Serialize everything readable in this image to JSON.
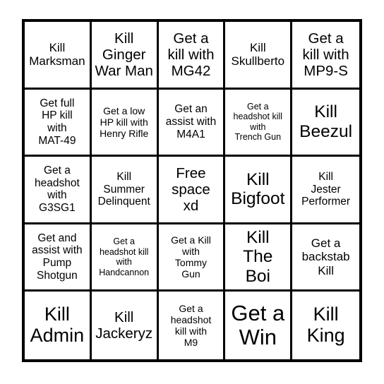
{
  "card": {
    "type": "bingo-card",
    "rows": 5,
    "columns": 5,
    "border_color": "#000000",
    "background_color": "#ffffff",
    "text_color": "#000000",
    "free_space_index": 12,
    "cells": [
      {
        "text": "Kill\nMarksman",
        "size": "l"
      },
      {
        "text": "Kill\nGinger\nWar Man",
        "size": "xl"
      },
      {
        "text": "Get a\nkill with\nMG42",
        "size": "xl"
      },
      {
        "text": "Kill\nSkullberto",
        "size": "l"
      },
      {
        "text": "Get a\nkill with\nMP9-S",
        "size": "xl"
      },
      {
        "text": "Get full\nHP kill\nwith\nMAT-49",
        "size": "m"
      },
      {
        "text": "Get a low\nHP kill with\nHenry Rifle",
        "size": "s"
      },
      {
        "text": "Get an\nassist with\nM4A1",
        "size": "m"
      },
      {
        "text": "Get a\nheadshot kill\nwith\nTrench Gun",
        "size": "xs"
      },
      {
        "text": "Kill\nBeezul",
        "size": "2xl"
      },
      {
        "text": "Get a\nheadshot\nwith\nG3SG1",
        "size": "m"
      },
      {
        "text": "Kill\nSummer\nDelinquent",
        "size": "m"
      },
      {
        "text": "Free\nspace\nxd",
        "size": "xl"
      },
      {
        "text": "Kill\nBigfoot",
        "size": "2xl"
      },
      {
        "text": "Kill\nJester\nPerformer",
        "size": "m"
      },
      {
        "text": "Get and\nassist with\nPump\nShotgun",
        "size": "m"
      },
      {
        "text": "Get a\nheadshot kill\nwith\nHandcannon",
        "size": "xs"
      },
      {
        "text": "Get a Kill\nwith\nTommy\nGun",
        "size": "s"
      },
      {
        "text": "Kill\nThe\nBoi",
        "size": "2xl"
      },
      {
        "text": "Get a\nbackstab\nKill",
        "size": "l"
      },
      {
        "text": "Kill\nAdmin",
        "size": "3xl"
      },
      {
        "text": "Kill\nJackeryz",
        "size": "xl"
      },
      {
        "text": "Get a\nheadshot\nkill with\nM9",
        "size": "s"
      },
      {
        "text": "Get a\nWin",
        "size": "4xl"
      },
      {
        "text": "Kill\nKing",
        "size": "3xl"
      }
    ]
  }
}
